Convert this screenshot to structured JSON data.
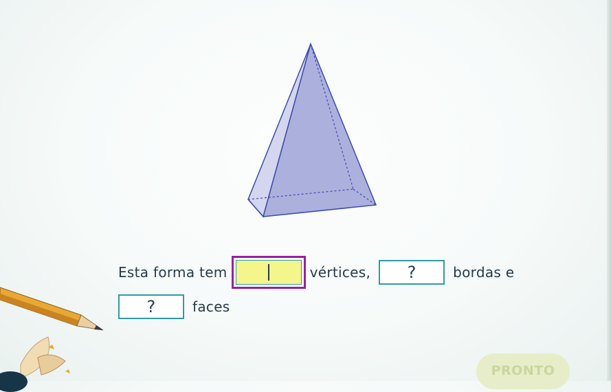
{
  "question": {
    "text_1": "Esta forma tem",
    "text_2": "vértices,",
    "text_3": "bordas e",
    "text_4": "faces"
  },
  "inputs": {
    "vertices_value": "",
    "edges_placeholder": "?",
    "faces_placeholder": "?"
  },
  "submit_button": {
    "label": "PRONTO",
    "enabled": false
  },
  "colors": {
    "active_border": "#9b1ea0",
    "active_fill": "#f4f58a",
    "box_border": "#2e9aa8",
    "pyramid_fill": "#a9add9",
    "pyramid_edge": "#3a4ab0",
    "button_disabled": "#e6edc8"
  },
  "icons": [
    "pencil-icon",
    "pencil-shavings-icon"
  ]
}
